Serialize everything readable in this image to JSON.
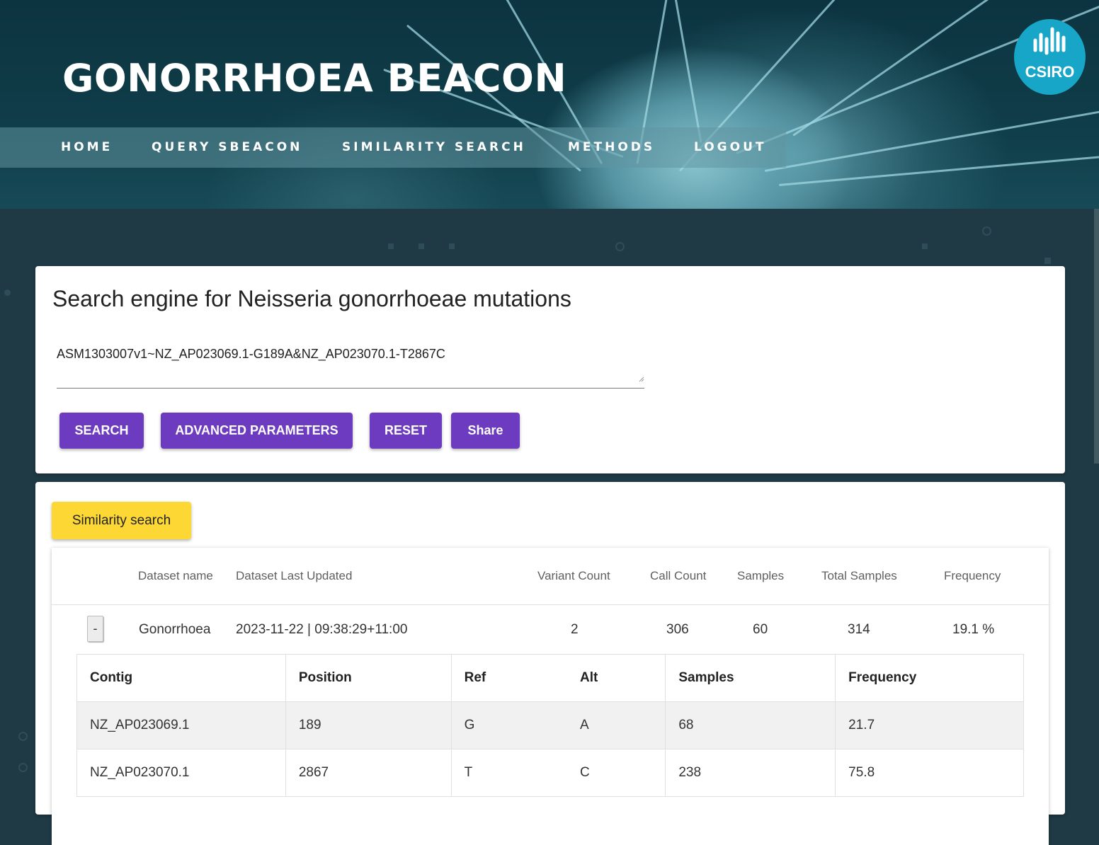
{
  "header": {
    "title": "GONORRHOEA BEACON",
    "logo_text": "CSIRO",
    "nav": [
      "HOME",
      "QUERY SBEACON",
      "SIMILARITY SEARCH",
      "METHODS",
      "LOGOUT"
    ]
  },
  "search": {
    "title": "Search engine for Neisseria gonorrhoeae mutations",
    "query_value": "ASM1303007v1~NZ_AP023069.1-G189A&NZ_AP023070.1-T2867C",
    "buttons": {
      "search": "SEARCH",
      "advanced": "ADVANCED PARAMETERS",
      "reset": "RESET",
      "share": "Share"
    }
  },
  "results": {
    "similarity_button": "Similarity search",
    "columns": [
      "Dataset name",
      "Dataset Last Updated",
      "Variant Count",
      "Call Count",
      "Samples",
      "Total Samples",
      "Frequency"
    ],
    "row": {
      "toggle": "-",
      "dataset_name": "Gonorrhoea",
      "last_updated": "2023-11-22 | 09:38:29+11:00",
      "variant_count": "2",
      "call_count": "306",
      "samples": "60",
      "total_samples": "314",
      "frequency": "19.1 %"
    },
    "variants": {
      "columns": [
        "Contig",
        "Position",
        "Ref",
        "Alt",
        "Samples",
        "Frequency"
      ],
      "rows": [
        [
          "NZ_AP023069.1",
          "189",
          "G",
          "A",
          "68",
          "21.7"
        ],
        [
          "NZ_AP023070.1",
          "2867",
          "T",
          "C",
          "238",
          "75.8"
        ]
      ]
    }
  },
  "colors": {
    "primary_button": "#6d3bbf",
    "similarity_button": "#fdd835",
    "page_background": "#1f3a45",
    "logo": "#18a6c8"
  }
}
